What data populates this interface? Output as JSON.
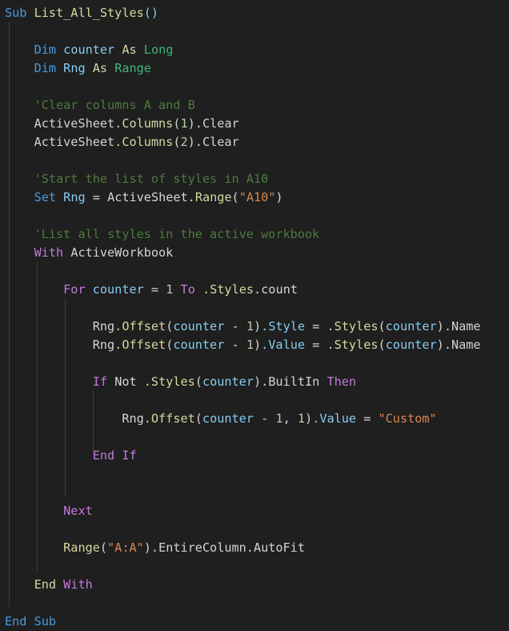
{
  "editor": {
    "background_color": "#1e1f1e",
    "language": "vba",
    "font_size_px": 15,
    "indent_guide_color": "#5a5a5a",
    "theme_colors": {
      "keyword_blue": "#4a9ae0",
      "keyword_purple": "#c678dd",
      "function_yellow": "#d7d7a0",
      "variable_blue": "#88ccf2",
      "type_teal": "#3fb57a",
      "number_green": "#b5cea8",
      "string_orange": "#d98555",
      "comment_green": "#4e7a3e",
      "default_text": "#d4d4d4"
    }
  },
  "code": {
    "title": "List_All_Styles",
    "lines": [
      {
        "n": 1,
        "indent": 0,
        "text": "Sub List_All_Styles()"
      },
      {
        "n": 2,
        "indent": 0,
        "text": ""
      },
      {
        "n": 3,
        "indent": 1,
        "text": "Dim counter As Long"
      },
      {
        "n": 4,
        "indent": 1,
        "text": "Dim Rng As Range"
      },
      {
        "n": 5,
        "indent": 0,
        "text": ""
      },
      {
        "n": 6,
        "indent": 1,
        "text": "'Clear columns A and B"
      },
      {
        "n": 7,
        "indent": 1,
        "text": "ActiveSheet.Columns(1).Clear"
      },
      {
        "n": 8,
        "indent": 1,
        "text": "ActiveSheet.Columns(2).Clear"
      },
      {
        "n": 9,
        "indent": 0,
        "text": ""
      },
      {
        "n": 10,
        "indent": 1,
        "text": "'Start the list of styles in A10"
      },
      {
        "n": 11,
        "indent": 1,
        "text": "Set Rng = ActiveSheet.Range(\"A10\")"
      },
      {
        "n": 12,
        "indent": 0,
        "text": ""
      },
      {
        "n": 13,
        "indent": 1,
        "text": "'List all styles in the active workbook"
      },
      {
        "n": 14,
        "indent": 1,
        "text": "With ActiveWorkbook"
      },
      {
        "n": 15,
        "indent": 0,
        "text": ""
      },
      {
        "n": 16,
        "indent": 2,
        "text": "For counter = 1 To .Styles.count"
      },
      {
        "n": 17,
        "indent": 0,
        "text": ""
      },
      {
        "n": 18,
        "indent": 3,
        "text": "Rng.Offset(counter - 1).Style = .Styles(counter).Name"
      },
      {
        "n": 19,
        "indent": 3,
        "text": "Rng.Offset(counter - 1).Value = .Styles(counter).Name"
      },
      {
        "n": 20,
        "indent": 0,
        "text": ""
      },
      {
        "n": 21,
        "indent": 3,
        "text": "If Not .Styles(counter).BuiltIn Then"
      },
      {
        "n": 22,
        "indent": 0,
        "text": ""
      },
      {
        "n": 23,
        "indent": 4,
        "text": "Rng.Offset(counter - 1, 1).Value = \"Custom\""
      },
      {
        "n": 24,
        "indent": 0,
        "text": ""
      },
      {
        "n": 25,
        "indent": 3,
        "text": "End If"
      },
      {
        "n": 26,
        "indent": 0,
        "text": ""
      },
      {
        "n": 27,
        "indent": 0,
        "text": ""
      },
      {
        "n": 28,
        "indent": 2,
        "text": "Next"
      },
      {
        "n": 29,
        "indent": 0,
        "text": ""
      },
      {
        "n": 30,
        "indent": 2,
        "text": "Range(\"A:A\").EntireColumn.AutoFit"
      },
      {
        "n": 31,
        "indent": 0,
        "text": ""
      },
      {
        "n": 32,
        "indent": 1,
        "text": "End With"
      },
      {
        "n": 33,
        "indent": 0,
        "text": ""
      },
      {
        "n": 34,
        "indent": 0,
        "text": "End Sub"
      }
    ],
    "tokens": {
      "sub": "Sub",
      "proc_name": "List_All_Styles",
      "parens_empty": "()",
      "dim": "Dim",
      "counter": "counter",
      "as": "As",
      "long": "Long",
      "rng": "Rng",
      "range_type": "Range",
      "comment_clear": "'Clear columns A and B",
      "activesheet": "ActiveSheet",
      "dot_columns": ".Columns",
      "num_1": "1",
      "num_2": "2",
      "dot_clear": ".Clear",
      "comment_start": "'Start the list of styles in A10",
      "set": "Set",
      "eq": "=",
      "dot_range": ".Range",
      "str_a10": "\"A10\"",
      "comment_list": "'List all styles in the active workbook",
      "with": "With",
      "activeworkbook": "ActiveWorkbook",
      "for": "For",
      "to": "To",
      "dot_styles": ".Styles",
      "dot_count": ".count",
      "dot_offset": ".Offset",
      "minus": "-",
      "dot_style": ".Style",
      "dot_value": ".Value",
      "dot_name": ".Name",
      "if": "If",
      "not": "Not",
      "dot_builtin": ".BuiltIn",
      "then": "Then",
      "str_custom": "\"Custom\"",
      "end": "End",
      "end_if": "End If",
      "next": "Next",
      "range_fn": "Range",
      "str_aa": "\"A:A\"",
      "dot_entirecolumn": ".EntireColumn",
      "dot_autofit": ".AutoFit",
      "end_with_end": "End",
      "end_with_with": "With",
      "end_sub": "End Sub"
    }
  }
}
